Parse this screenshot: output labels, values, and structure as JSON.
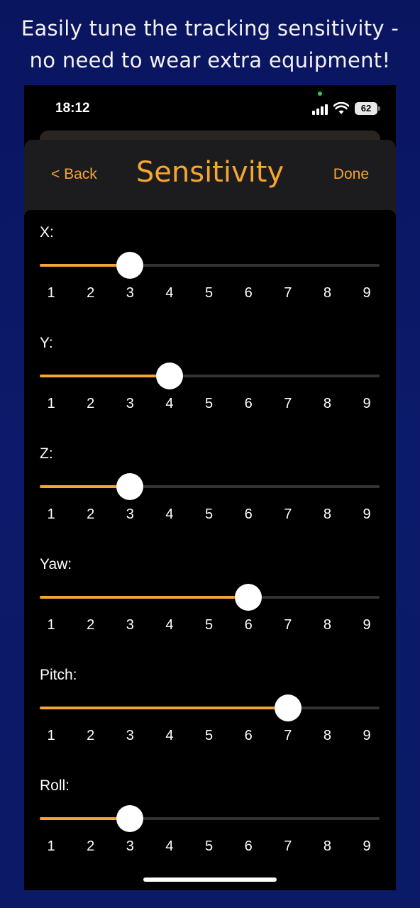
{
  "promo": {
    "line1": "Easily tune the tracking sensitivity -",
    "line2": "no need to wear extra equipment!"
  },
  "status_bar": {
    "time": "18:12",
    "battery": "62",
    "icons": [
      "signal-icon",
      "wifi-icon",
      "battery-icon"
    ]
  },
  "nav": {
    "back_label": "< Back",
    "title": "Sensitivity",
    "done_label": "Done"
  },
  "colors": {
    "accent": "#f5a531",
    "track": "#333336",
    "background": "#000000",
    "promo_background": "#0b1a6a"
  },
  "scale": [
    "1",
    "2",
    "3",
    "4",
    "5",
    "6",
    "7",
    "8",
    "9"
  ],
  "scale_min": 1,
  "scale_max": 9,
  "sliders": [
    {
      "label": "X:",
      "value": 3
    },
    {
      "label": "Y:",
      "value": 4
    },
    {
      "label": "Z:",
      "value": 3
    },
    {
      "label": "Yaw:",
      "value": 6
    },
    {
      "label": "Pitch:",
      "value": 7
    },
    {
      "label": "Roll:",
      "value": 3
    }
  ]
}
